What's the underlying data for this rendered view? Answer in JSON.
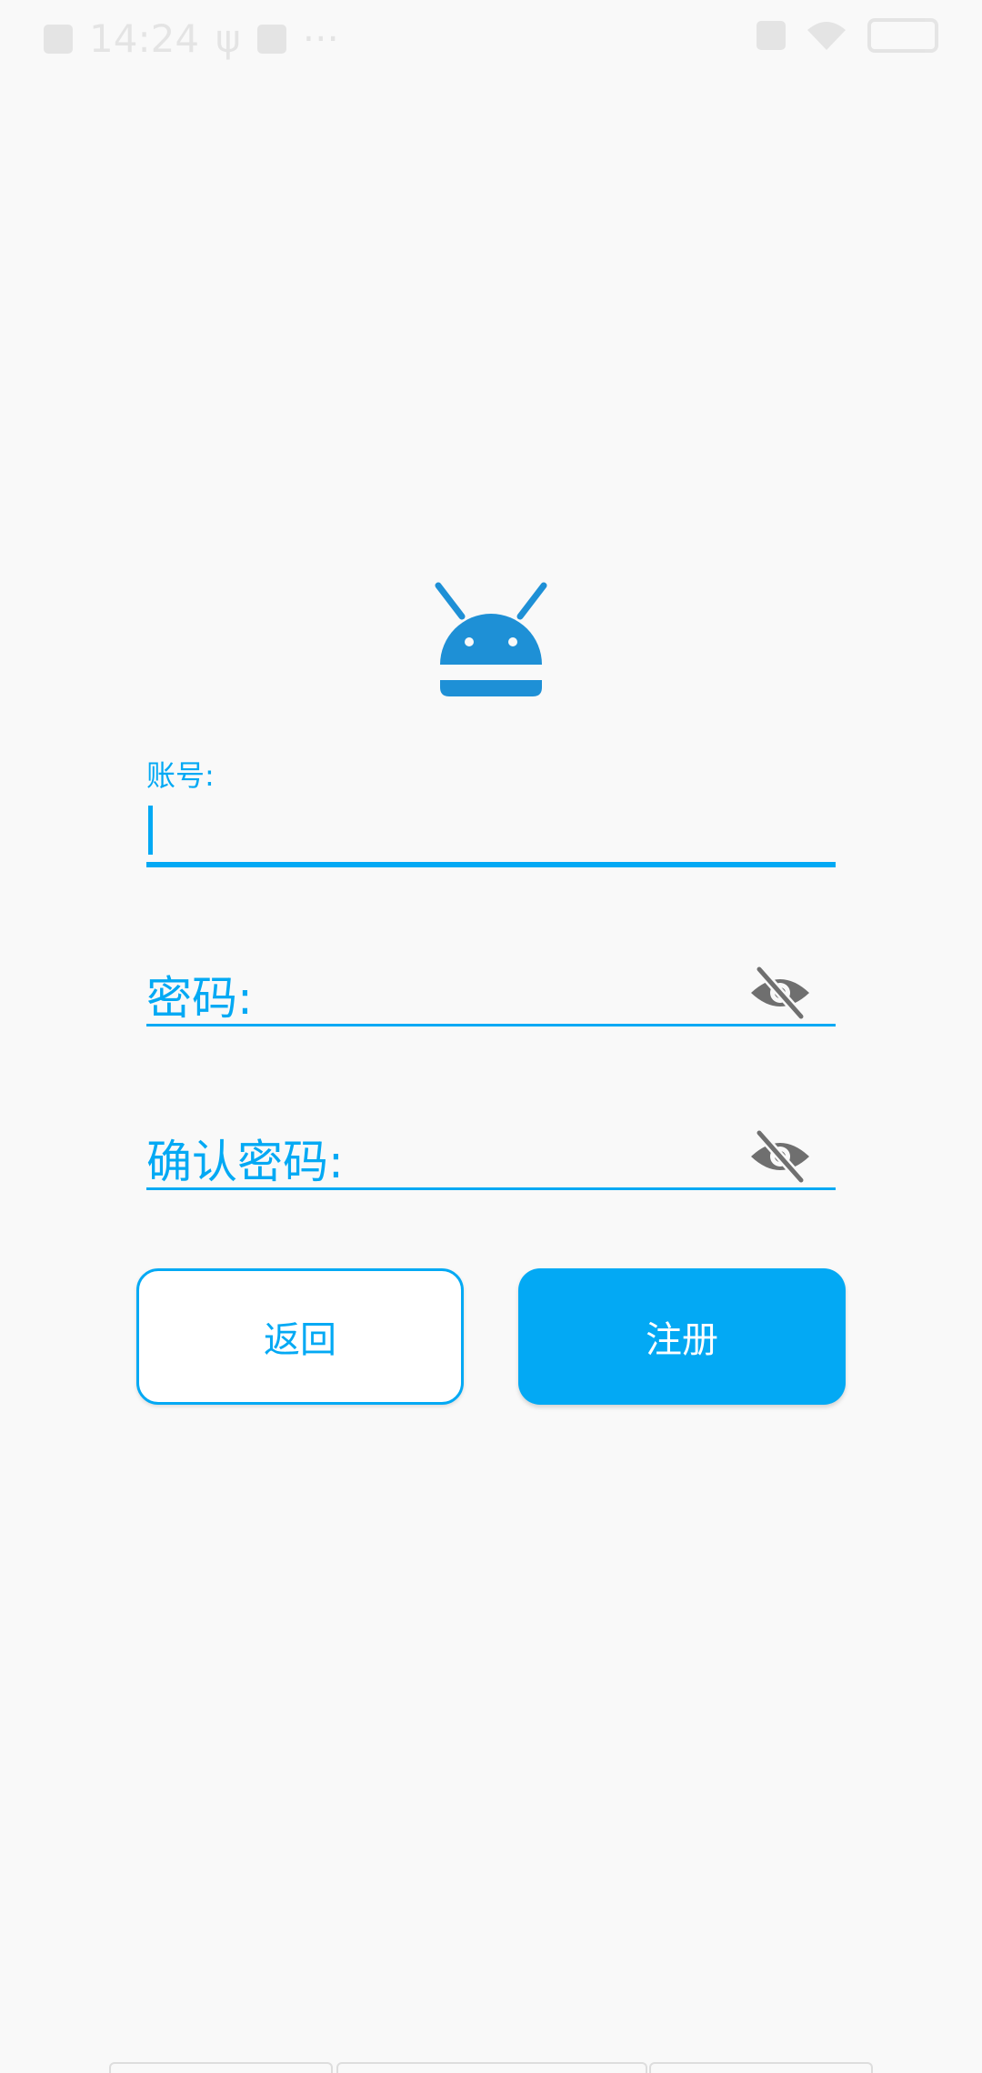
{
  "status_bar": {
    "time": "14:24",
    "more": "···"
  },
  "form": {
    "account_label": "账号:",
    "password_label": "密码:",
    "confirm_label": "确认密码:"
  },
  "buttons": {
    "back_label": "返回",
    "register_label": "注册"
  },
  "colors": {
    "accent": "#03a9f4",
    "eye_icon": "#6f6f6f",
    "background": "#f9f9f9"
  },
  "icons": {
    "logo": "android-robot-icon",
    "password_toggle": "eye-off-icon",
    "confirm_toggle": "eye-off-icon"
  }
}
